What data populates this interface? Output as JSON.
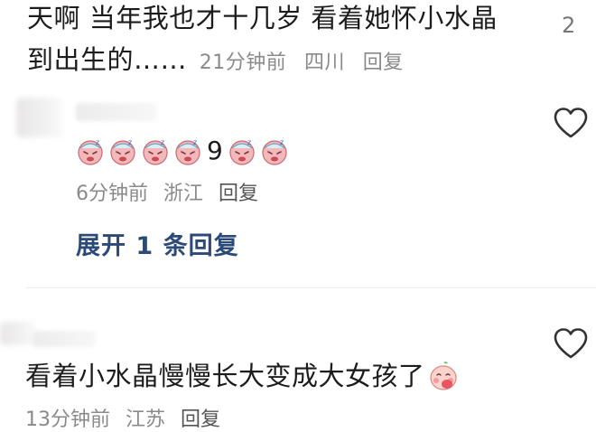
{
  "comment1": {
    "line1": "天啊 当年我也才十几岁 看着她怀小水晶",
    "line2": "到出生的……",
    "time": "21分钟前",
    "location": "四川",
    "reply": "回复",
    "like_count": "2"
  },
  "comment2": {
    "emoji_digit": "9",
    "emoji_name": "sleepy-face-emoji",
    "time": "6分钟前",
    "location": "浙江",
    "reply": "回复",
    "expand": "展开 1 条回复"
  },
  "comment3": {
    "text": "看着小水晶慢慢长大变成大女孩了",
    "emoji_name": "shy-face-emoji",
    "time": "13分钟前",
    "location": "江苏",
    "reply": "回复"
  },
  "colors": {
    "expand": "#2c4a78",
    "meta": "#8a8a8a",
    "text": "#1c1c1c"
  }
}
